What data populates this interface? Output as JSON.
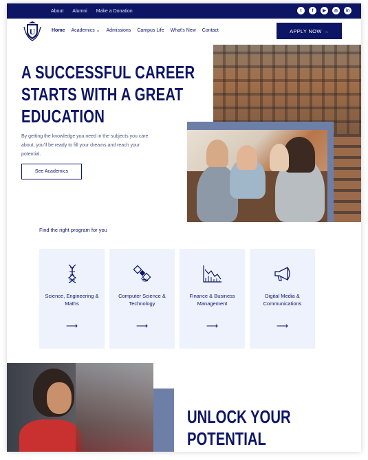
{
  "topbar": {
    "links": [
      "About",
      "Alumni",
      "Make a Donation"
    ],
    "social": [
      "twitter-icon",
      "facebook-icon",
      "youtube-icon",
      "instagram-icon",
      "linkedin-icon"
    ]
  },
  "logo": {
    "letter": "U"
  },
  "nav": {
    "items": [
      "Home",
      "Academics",
      "Admissions",
      "Campus Life",
      "What's New",
      "Contact"
    ],
    "apply_label": "APPLY NOW →"
  },
  "hero": {
    "title_lines": [
      "A SUCCESSFUL CAREER",
      "STARTS WITH A GREAT",
      "EDUCATION"
    ],
    "description": "By getting the knowledge you need in the subjects you care about, you'll be ready to fill your dreams and reach your potential.",
    "button_label": "See Academics"
  },
  "programs": {
    "heading": "Find the right program for you",
    "cards": [
      {
        "label": "Science, Engineering & Maths",
        "icon": "dna-icon",
        "arrow": "⟶"
      },
      {
        "label": "Computer Science & Technology",
        "icon": "satellite-icon",
        "arrow": "⟶"
      },
      {
        "label": "Finance & Business Management",
        "icon": "chart-icon",
        "arrow": "⟶"
      },
      {
        "label": "Digital Media & Communications",
        "icon": "megaphone-icon",
        "arrow": "⟶"
      }
    ]
  },
  "bottom": {
    "title_lines": [
      "UNLOCK YOUR",
      "POTENTIAL"
    ]
  },
  "colors": {
    "brand": "#0d1565",
    "accent": "#6e7fa7",
    "card_bg": "#eef2fc"
  }
}
